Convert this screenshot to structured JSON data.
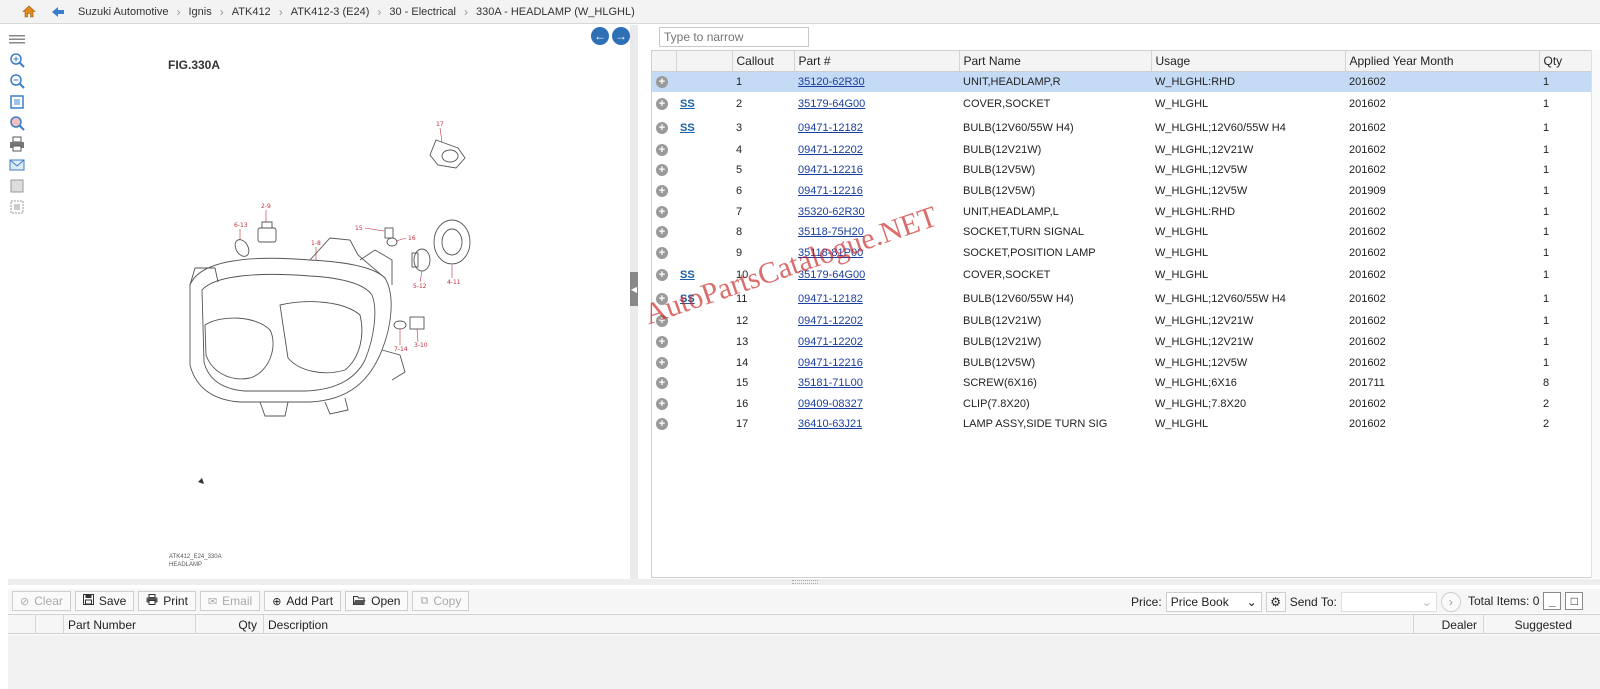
{
  "breadcrumb": [
    "Suzuki Automotive",
    "Ignis",
    "ATK412",
    "ATK412-3 (E24)",
    "30 - Electrical",
    "330A - HEADLAMP (W_HLGHL)"
  ],
  "figure": {
    "title": "FIG.330A",
    "note_line1": "ATK412_E24_330A",
    "note_line2": "HEADLAMP",
    "labels": [
      "17",
      "2-9",
      "6-13",
      "1-8",
      "15",
      "16",
      "5-12",
      "4-11",
      "3-10",
      "7-14"
    ]
  },
  "filter": {
    "placeholder": "Type to narrow"
  },
  "parts_table": {
    "headers": [
      "",
      "",
      "Callout",
      "Part #",
      "Part Name",
      "Usage",
      "Applied Year Month",
      "Qty"
    ],
    "rows": [
      {
        "ss": "",
        "callout": "1",
        "part": "35120-62R30",
        "name": "UNIT,HEADLAMP,R",
        "usage": "W_HLGHL:RHD",
        "ym": "201602",
        "qty": "1"
      },
      {
        "ss": "SS",
        "callout": "2",
        "part": "35179-64G00",
        "name": "COVER,SOCKET",
        "usage": "W_HLGHL",
        "ym": "201602",
        "qty": "1"
      },
      {
        "ss": "SS",
        "callout": "3",
        "part": "09471-12182",
        "name": "BULB(12V60/55W H4)",
        "usage": "W_HLGHL;12V60/55W H4",
        "ym": "201602",
        "qty": "1"
      },
      {
        "ss": "",
        "callout": "4",
        "part": "09471-12202",
        "name": "BULB(12V21W)",
        "usage": "W_HLGHL;12V21W",
        "ym": "201602",
        "qty": "1"
      },
      {
        "ss": "",
        "callout": "5",
        "part": "09471-12216",
        "name": "BULB(12V5W)",
        "usage": "W_HLGHL;12V5W",
        "ym": "201602",
        "qty": "1"
      },
      {
        "ss": "",
        "callout": "6",
        "part": "09471-12216",
        "name": "BULB(12V5W)",
        "usage": "W_HLGHL;12V5W",
        "ym": "201909",
        "qty": "1"
      },
      {
        "ss": "",
        "callout": "7",
        "part": "35320-62R30",
        "name": "UNIT,HEADLAMP,L",
        "usage": "W_HLGHL:RHD",
        "ym": "201602",
        "qty": "1"
      },
      {
        "ss": "",
        "callout": "8",
        "part": "35118-75H20",
        "name": "SOCKET,TURN SIGNAL",
        "usage": "W_HLGHL",
        "ym": "201602",
        "qty": "1"
      },
      {
        "ss": "",
        "callout": "9",
        "part": "35118-81P00",
        "name": "SOCKET,POSITION LAMP",
        "usage": "W_HLGHL",
        "ym": "201602",
        "qty": "1"
      },
      {
        "ss": "SS",
        "callout": "10",
        "part": "35179-64G00",
        "name": "COVER,SOCKET",
        "usage": "W_HLGHL",
        "ym": "201602",
        "qty": "1"
      },
      {
        "ss": "SS",
        "callout": "11",
        "part": "09471-12182",
        "name": "BULB(12V60/55W H4)",
        "usage": "W_HLGHL;12V60/55W H4",
        "ym": "201602",
        "qty": "1"
      },
      {
        "ss": "",
        "callout": "12",
        "part": "09471-12202",
        "name": "BULB(12V21W)",
        "usage": "W_HLGHL;12V21W",
        "ym": "201602",
        "qty": "1"
      },
      {
        "ss": "",
        "callout": "13",
        "part": "09471-12202",
        "name": "BULB(12V21W)",
        "usage": "W_HLGHL;12V21W",
        "ym": "201602",
        "qty": "1"
      },
      {
        "ss": "",
        "callout": "14",
        "part": "09471-12216",
        "name": "BULB(12V5W)",
        "usage": "W_HLGHL;12V5W",
        "ym": "201602",
        "qty": "1"
      },
      {
        "ss": "",
        "callout": "15",
        "part": "35181-71L00",
        "name": "SCREW(6X16)",
        "usage": "W_HLGHL;6X16",
        "ym": "201711",
        "qty": "8"
      },
      {
        "ss": "",
        "callout": "16",
        "part": "09409-08327",
        "name": "CLIP(7.8X20)",
        "usage": "W_HLGHL;7.8X20",
        "ym": "201602",
        "qty": "2"
      },
      {
        "ss": "",
        "callout": "17",
        "part": "36410-63J21",
        "name": "LAMP ASSY,SIDE TURN SIG",
        "usage": "W_HLGHL",
        "ym": "201602",
        "qty": "2"
      }
    ]
  },
  "toolbar": {
    "clear": "Clear",
    "save": "Save",
    "print": "Print",
    "email": "Email",
    "add_part": "Add Part",
    "open": "Open",
    "copy": "Copy",
    "price_label": "Price:",
    "price_value": "Price Book",
    "send_to_label": "Send To:",
    "send_to_value": "",
    "total_items": "Total Items: 0"
  },
  "cart_headers": [
    "Part Number",
    "Qty",
    "Description",
    "Dealer",
    "Suggested"
  ],
  "watermark": "AutoPartsCatalogue.NET",
  "colors": {
    "selected_row": "#c5dbf5",
    "link": "#1a3fa0",
    "accent": "#2f6fb5",
    "watermark": "#c81e1e"
  }
}
